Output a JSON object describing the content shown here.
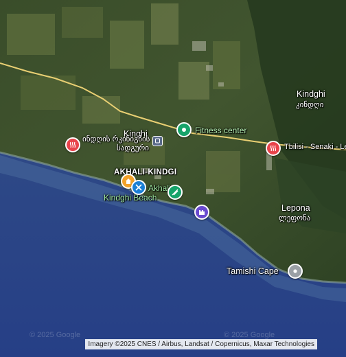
{
  "map": {
    "places": {
      "kindghi_north": "Kindghi",
      "kindghi_north_geo": "კინდღი",
      "kinghi": "Kinghi",
      "akhali_kindgi": "AKHALI-KINDGI",
      "lepona": "Lepona",
      "lepona_geo": "ლეფონა",
      "road_label": "Tbilisi - Senaki - Le"
    },
    "pois": {
      "fitness": "Fitness center",
      "hotspring_geo_line1": "ინდღის რკინიგზის",
      "hotspring_geo_line2": "სადგური",
      "kindghi_beach_line1": "Akhali",
      "kindghi_beach_line2": "Kindghi Beach",
      "tamishi_cape": "Tamishi Cape"
    },
    "watermark_left": "© 2025 Google",
    "watermark_right": "© 2025 Google",
    "attribution": "Imagery ©2025 CNES / Airbus, Landsat / Copernicus, Maxar Technologies",
    "colors": {
      "hot_spring_pin": "#e8434b",
      "park_pin": "#17a36a",
      "lodging_pin": "#f2a22a",
      "restaurant_pin": "#1a7fd6",
      "landmark_pin": "#6a4bd0",
      "generic_pin": "#9aa0a6",
      "road": "#e9cf73"
    },
    "icons": {
      "hot_spring": "hot-spring-icon",
      "fitness": "fitness-icon",
      "lodging": "home-icon",
      "restaurant": "restaurant-icon",
      "park": "park-icon",
      "castle": "castle-icon",
      "generic": "place-pin-icon",
      "train": "train-station-icon"
    }
  }
}
